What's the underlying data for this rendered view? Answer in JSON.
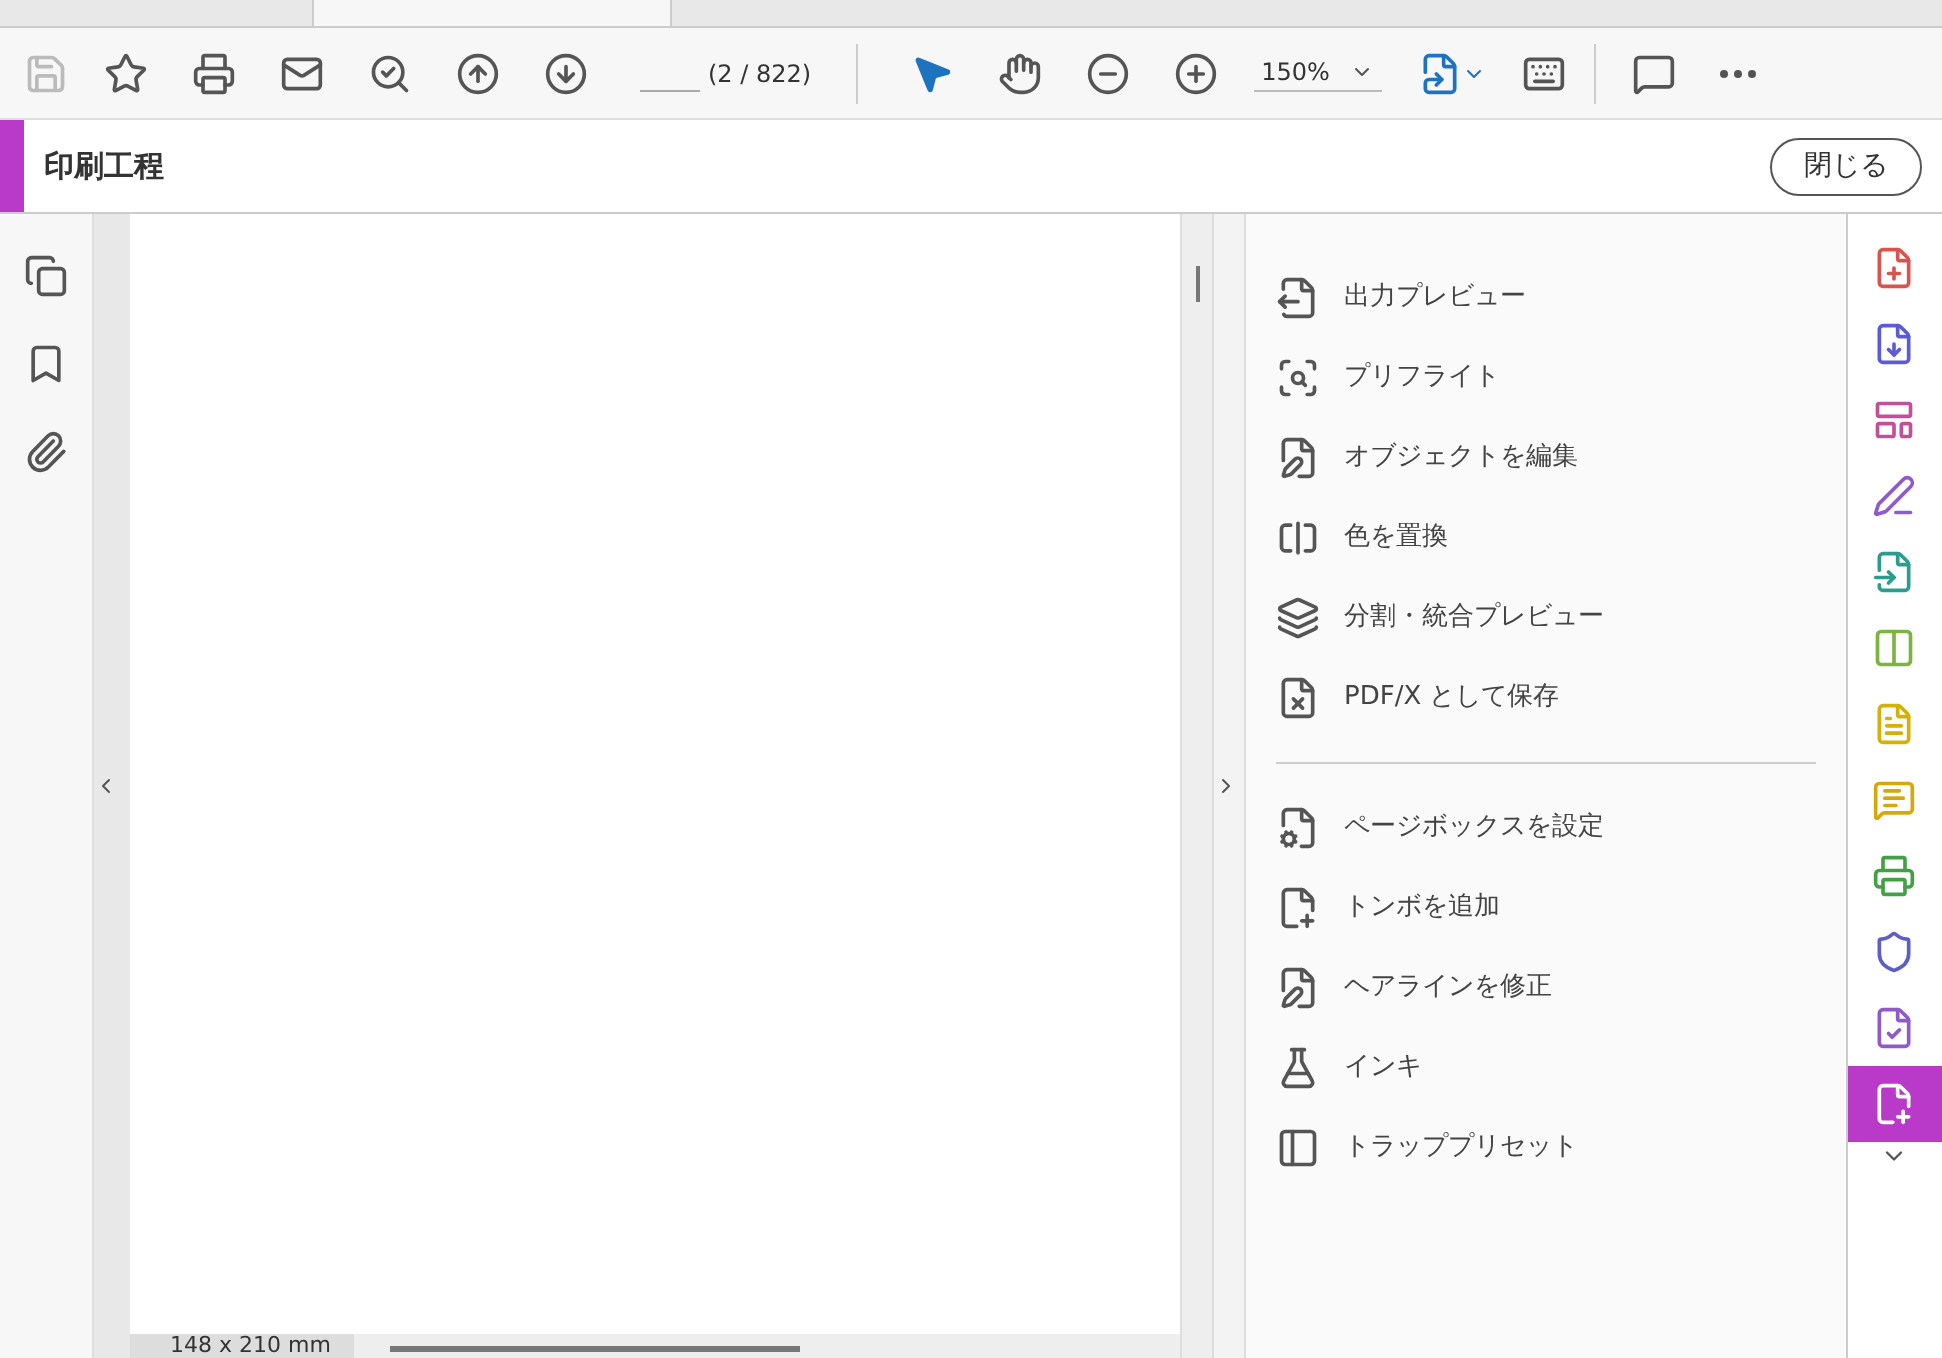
{
  "toolbar": {
    "page_count": "(2 / 822)",
    "zoom": "150%",
    "tools": [
      {
        "kind": "select",
        "selected": true
      },
      {
        "kind": "hand",
        "selected": false
      }
    ]
  },
  "header": {
    "title": "印刷工程",
    "close_button": "閉じる"
  },
  "document": {
    "page_size": "148 x 210 mm"
  },
  "tools_panel": {
    "groups": [
      {
        "items": [
          {
            "kind": "output",
            "label": "出力プレビュー"
          },
          {
            "kind": "preflight",
            "label": "プリフライト"
          },
          {
            "kind": "edit",
            "label": "オブジェクトを編集"
          },
          {
            "kind": "color",
            "label": "色を置換"
          },
          {
            "kind": "flatten",
            "label": "分割・統合プレビュー"
          },
          {
            "kind": "pdfx",
            "label": "PDF/X として保存"
          }
        ]
      },
      {
        "items": [
          {
            "kind": "pagebox",
            "label": "ページボックスを設定"
          },
          {
            "kind": "marks",
            "label": "トンボを追加"
          },
          {
            "kind": "hairline",
            "label": "ヘアラインを修正"
          },
          {
            "kind": "ink",
            "label": "インキ"
          },
          {
            "kind": "trap",
            "label": "トラッププリセット"
          }
        ]
      }
    ]
  },
  "right_rail": {
    "items": [
      {
        "kind": "create",
        "color": "#d9534f",
        "selected": false
      },
      {
        "kind": "export",
        "color": "#5b5bd6",
        "selected": false
      },
      {
        "kind": "organize",
        "color": "#c0509a",
        "selected": false
      },
      {
        "kind": "sign",
        "color": "#8e5bc8",
        "selected": false
      },
      {
        "kind": "send",
        "color": "#2a9d8f",
        "selected": false
      },
      {
        "kind": "compare",
        "color": "#7cb342",
        "selected": false
      },
      {
        "kind": "comment-doc",
        "color": "#d4b106",
        "selected": false
      },
      {
        "kind": "comment",
        "color": "#d4a90a",
        "selected": false
      },
      {
        "kind": "print",
        "color": "#43a047",
        "selected": false
      },
      {
        "kind": "protect",
        "color": "#5c5fc7",
        "selected": false
      },
      {
        "kind": "form",
        "color": "#8e5bc8",
        "selected": false
      },
      {
        "kind": "production",
        "color": "#ffffff",
        "selected": true
      }
    ]
  }
}
